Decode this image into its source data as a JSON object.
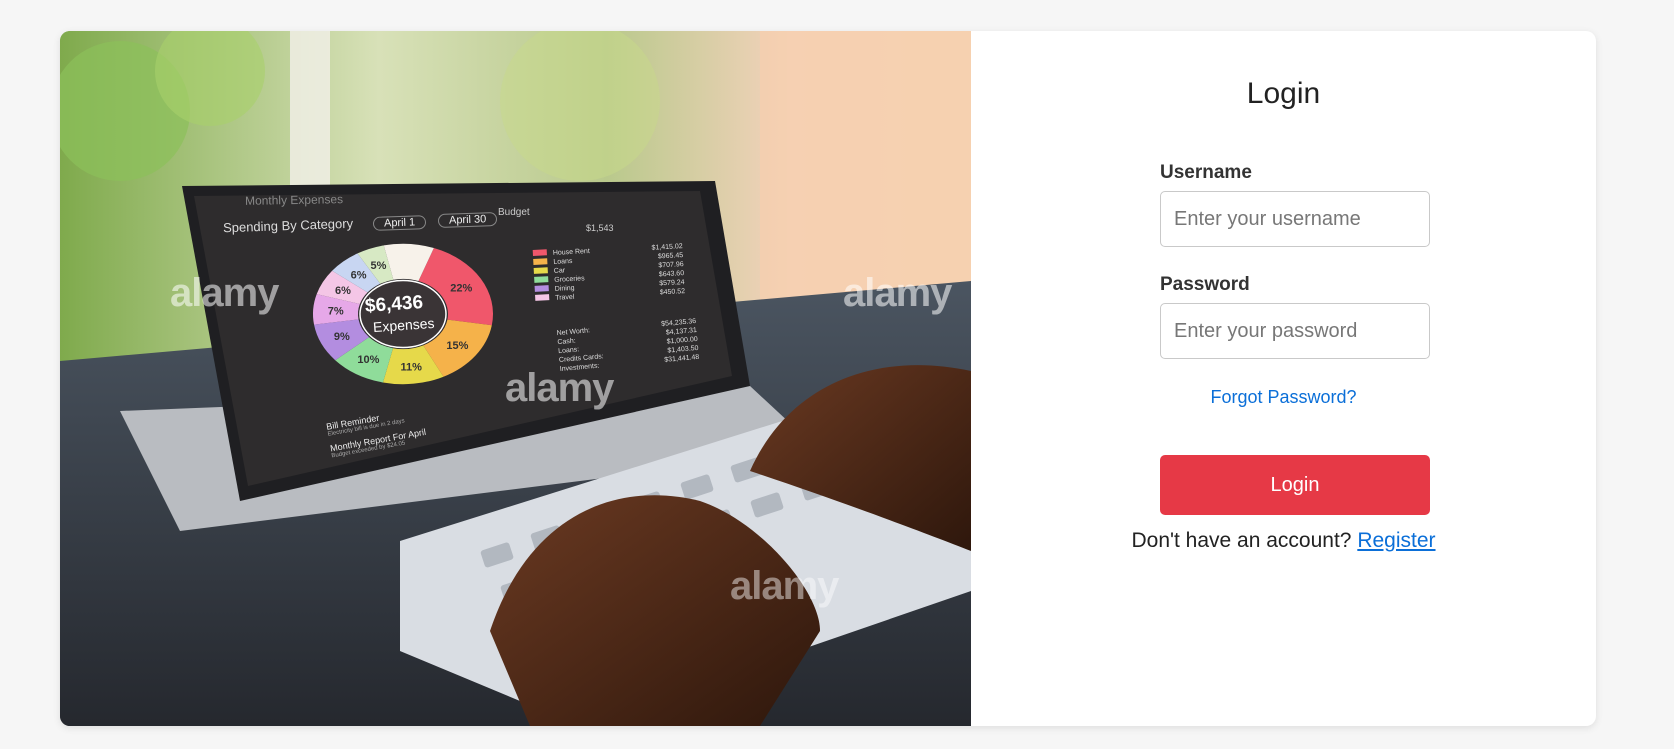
{
  "hero_image": {
    "screen": {
      "header": "Monthly Expenses",
      "section_title": "Spending By Category",
      "date_from": "April 1",
      "date_to": "April 30",
      "budget_label": "Budget",
      "budget_value": "$1,543",
      "donut_total": "$6,436",
      "donut_caption": "Expenses",
      "donut_slices": [
        {
          "label": "22%",
          "value": 22,
          "color": "#f0576b"
        },
        {
          "label": "15%",
          "value": 15,
          "color": "#f5b24a"
        },
        {
          "label": "11%",
          "value": 11,
          "color": "#e6d94a"
        },
        {
          "label": "10%",
          "value": 10,
          "color": "#8fdc9a"
        },
        {
          "label": "9%",
          "value": 9,
          "color": "#b38de0"
        },
        {
          "label": "7%",
          "value": 7,
          "color": "#e6a8e8"
        },
        {
          "label": "6%",
          "value": 6,
          "color": "#f4c6e6"
        },
        {
          "label": "6%",
          "value": 6,
          "color": "#c8d6f2"
        },
        {
          "label": "5%",
          "value": 5,
          "color": "#d7e9c4"
        },
        {
          "label": "",
          "value": 9,
          "color": "#f7f2ea"
        }
      ],
      "legend": [
        {
          "name": "House Rent",
          "amount": "$1,415.02",
          "color": "#f0576b"
        },
        {
          "name": "Loans",
          "amount": "$965.45",
          "color": "#f5b24a"
        },
        {
          "name": "Car",
          "amount": "$707.96",
          "color": "#e6d94a"
        },
        {
          "name": "Groceries",
          "amount": "$643.60",
          "color": "#8fdc9a"
        },
        {
          "name": "Dining",
          "amount": "$579.24",
          "color": "#b38de0"
        },
        {
          "name": "Travel",
          "amount": "$450.52",
          "color": "#f4c6e6"
        }
      ],
      "net_worth": [
        {
          "name": "Net Worth:",
          "amount": "$54,235.36"
        },
        {
          "name": "Cash:",
          "amount": "$4,137.31"
        },
        {
          "name": "Loans:",
          "amount": "$1,000.00"
        },
        {
          "name": "Credits Cards:",
          "amount": "$1,403.50"
        },
        {
          "name": "Investments:",
          "amount": "$31,441.48"
        }
      ],
      "notifications": [
        {
          "title": "Bill Reminder",
          "subtitle": "Electricity bill is due in 2 days"
        },
        {
          "title": "Monthly Report For April",
          "subtitle": "Budget exceeded by $24.05"
        }
      ]
    },
    "watermark": "alamy"
  },
  "form": {
    "title": "Login",
    "username_label": "Username",
    "username_placeholder": "Enter your username",
    "password_label": "Password",
    "password_placeholder": "Enter your password",
    "forgot_password": "Forgot Password?",
    "login_button": "Login",
    "register_prompt": "Don't have an account?",
    "register_link": "Register"
  },
  "colors": {
    "accent": "#e63946",
    "link": "#0b6fd8"
  }
}
